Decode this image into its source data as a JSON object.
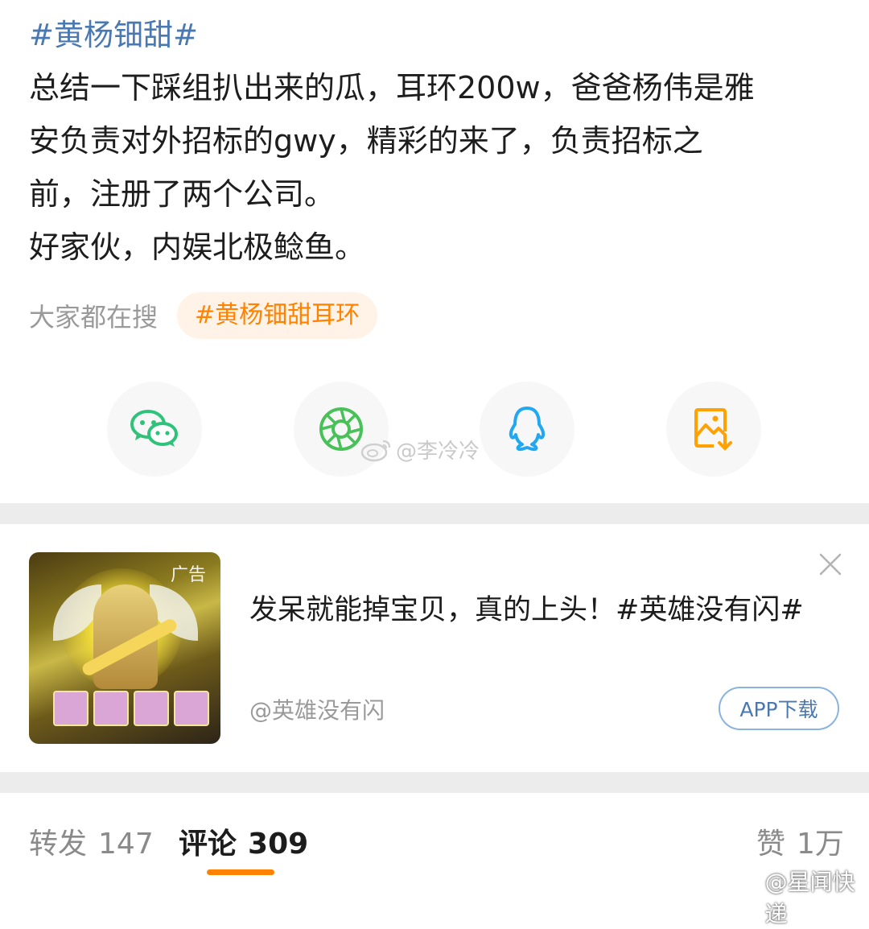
{
  "post": {
    "topic": "#黄杨钿甜#",
    "lines": [
      "总结一下踩组扒出来的瓜，耳环200w，爸爸杨伟是雅",
      "安负责对外招标的gwy，精彩的来了，负责招标之",
      "前，注册了两个公司。",
      "好家伙，内娱北极鲶鱼。"
    ],
    "search_label": "大家都在搜",
    "search_tag": "#黄杨钿甜耳环"
  },
  "share": {
    "items": [
      {
        "icon": "wechat-icon",
        "color": "#2fc27a"
      },
      {
        "icon": "moments-icon",
        "color": "#49c158"
      },
      {
        "icon": "qq-icon",
        "color": "#22a7f0"
      },
      {
        "icon": "save-image-icon",
        "color": "#ffa100"
      }
    ]
  },
  "watermarks": {
    "center": "@李冷冷",
    "bottom": "@星闻快递"
  },
  "ad": {
    "image_tag": "广告",
    "title": "发呆就能掉宝贝，真的上头！#英雄没有闪#",
    "source": "@英雄没有闪",
    "button": "APP下载"
  },
  "tabs": [
    {
      "label": "转发",
      "count": "147"
    },
    {
      "label": "评论",
      "count": "309"
    },
    {
      "label": "赞",
      "count": "1万"
    }
  ]
}
